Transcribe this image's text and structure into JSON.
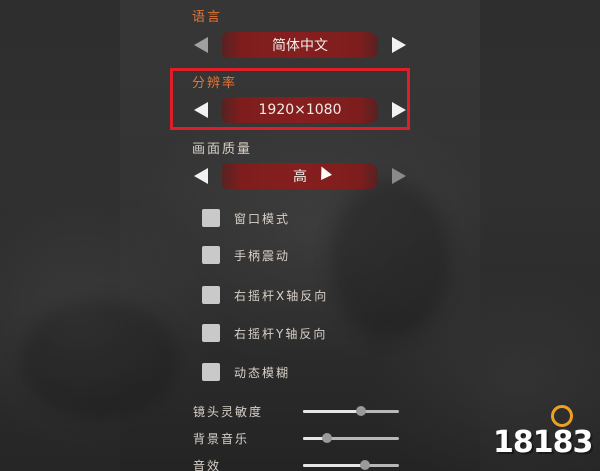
{
  "language": {
    "label": "语言",
    "value": "简体中文"
  },
  "resolution": {
    "label": "分辨率",
    "value": "1920×1080"
  },
  "quality": {
    "label": "画面质量",
    "value": "高"
  },
  "checkboxes": [
    {
      "label": "窗口模式",
      "checked": false
    },
    {
      "label": "手柄震动",
      "checked": false
    },
    {
      "label": "右摇杆X轴反向",
      "checked": false
    },
    {
      "label": "右摇杆Y轴反向",
      "checked": false
    },
    {
      "label": "动态模糊",
      "checked": false
    }
  ],
  "sliders": [
    {
      "label": "镜头灵敏度",
      "value": 0.6
    },
    {
      "label": "背景音乐",
      "value": 0.25
    },
    {
      "label": "音效",
      "value": 0.65
    }
  ],
  "watermark": {
    "text": "18183"
  },
  "colors": {
    "accent_orange": "#e0753a",
    "value_red": "#861f1f",
    "highlight_red": "#e01e2a"
  }
}
